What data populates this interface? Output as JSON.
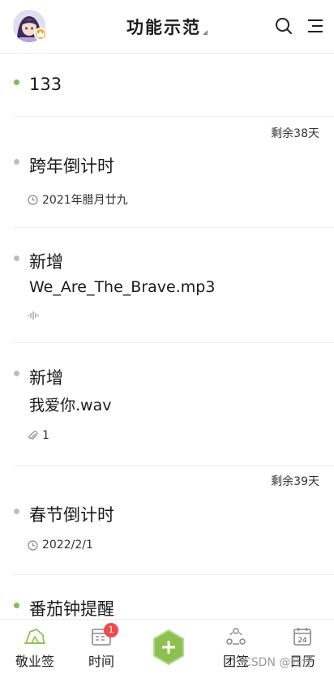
{
  "header": {
    "title": "功能示范",
    "avatar_icon": "avatar-icon",
    "search_icon": "search-icon",
    "menu_icon": "menu-icon"
  },
  "items": [
    {
      "title": "133",
      "dot": "green"
    },
    {
      "remaining": "剩余38天",
      "title": "跨年倒计时",
      "meta": "2021年腊月廿九",
      "meta_icon": "clock-icon",
      "dot": "gray"
    },
    {
      "title": "新增",
      "subtitle": "We_Are_The_Brave.mp3",
      "meta_icon": "audio-wave-icon",
      "dot": "gray"
    },
    {
      "title": "新增",
      "subtitle": "我爱你.wav",
      "meta": "1",
      "meta_icon": "paperclip-icon",
      "dot": "gray"
    },
    {
      "remaining": "剩余39天",
      "title": "春节倒计时",
      "meta": "2022/2/1",
      "meta_icon": "clock-icon",
      "dot": "gray"
    },
    {
      "title": "番茄钟提醒",
      "dot": "green"
    }
  ],
  "tabbar": {
    "tabs": [
      {
        "label": "敬业签",
        "icon": "notebook-icon"
      },
      {
        "label": "时间",
        "icon": "calendar-grid-icon",
        "badge": "1"
      },
      {
        "label": "",
        "icon": "plus-icon"
      },
      {
        "label": "团签",
        "icon": "team-icon"
      },
      {
        "label": "日历",
        "icon": "calendar-icon",
        "icon_text": "24"
      }
    ]
  },
  "watermark": "CSDN @旺仔",
  "colors": {
    "accent": "#8cc152",
    "dot_green": "#79c05a",
    "badge": "#ef4b4b"
  }
}
